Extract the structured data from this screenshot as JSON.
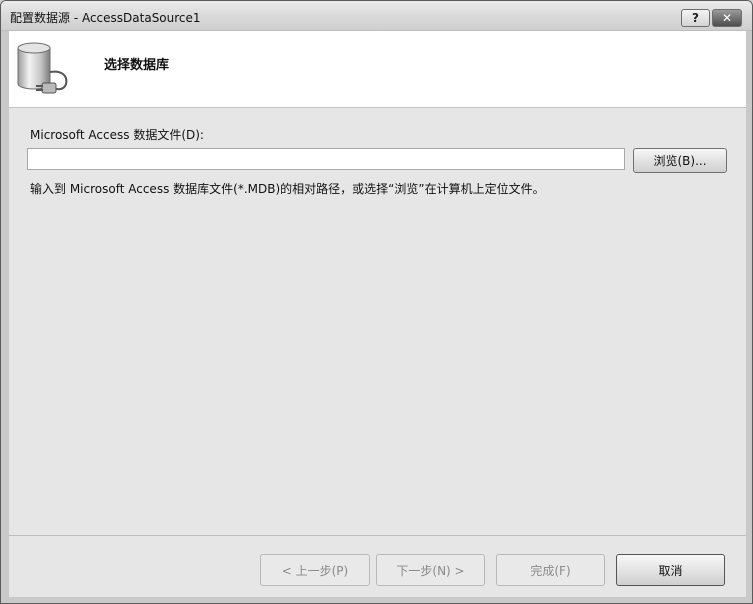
{
  "window": {
    "title": "配置数据源 - AccessDataSource1",
    "help_label": "?",
    "close_label": "✕"
  },
  "header": {
    "title": "选择数据库",
    "icon": "database-plug-icon"
  },
  "form": {
    "field_label": "Microsoft Access 数据文件(D):",
    "path_value": "",
    "browse_label": "浏览(B)...",
    "hint": "输入到 Microsoft Access 数据库文件(*.MDB)的相对路径，或选择“浏览”在计算机上定位文件。"
  },
  "footer": {
    "prev_label": "< 上一步(P)",
    "next_label": "下一步(N) >",
    "finish_label": "完成(F)",
    "cancel_label": "取消"
  }
}
